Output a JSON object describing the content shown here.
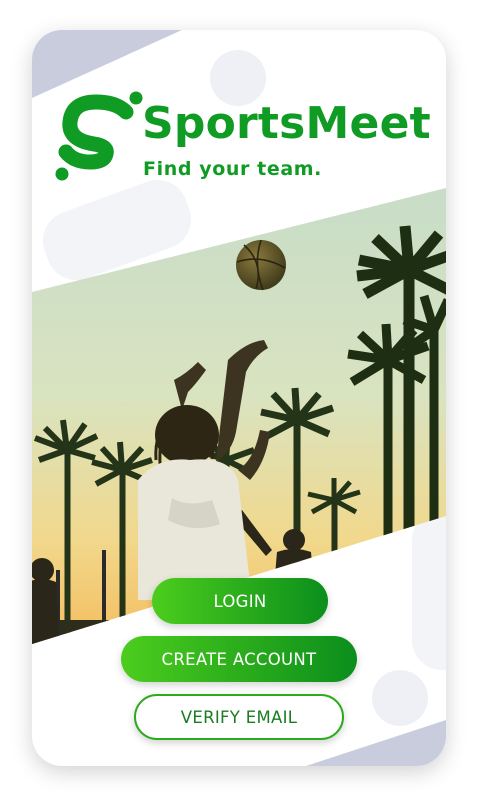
{
  "app": {
    "brand_light": "Sports",
    "brand_bold": "Meet",
    "tagline": "Find your team."
  },
  "buttons": {
    "login": "LOGIN",
    "create_account": "CREATE ACCOUNT",
    "verify_email": "VERIFY EMAIL"
  },
  "icons": {
    "logo": "s-letter-logo-icon"
  },
  "colors": {
    "brand_green": "#109b24",
    "button_gradient_start": "#4ccd1d",
    "button_gradient_end": "#0b8e1c",
    "corner_accent": "#c9ccdd"
  }
}
